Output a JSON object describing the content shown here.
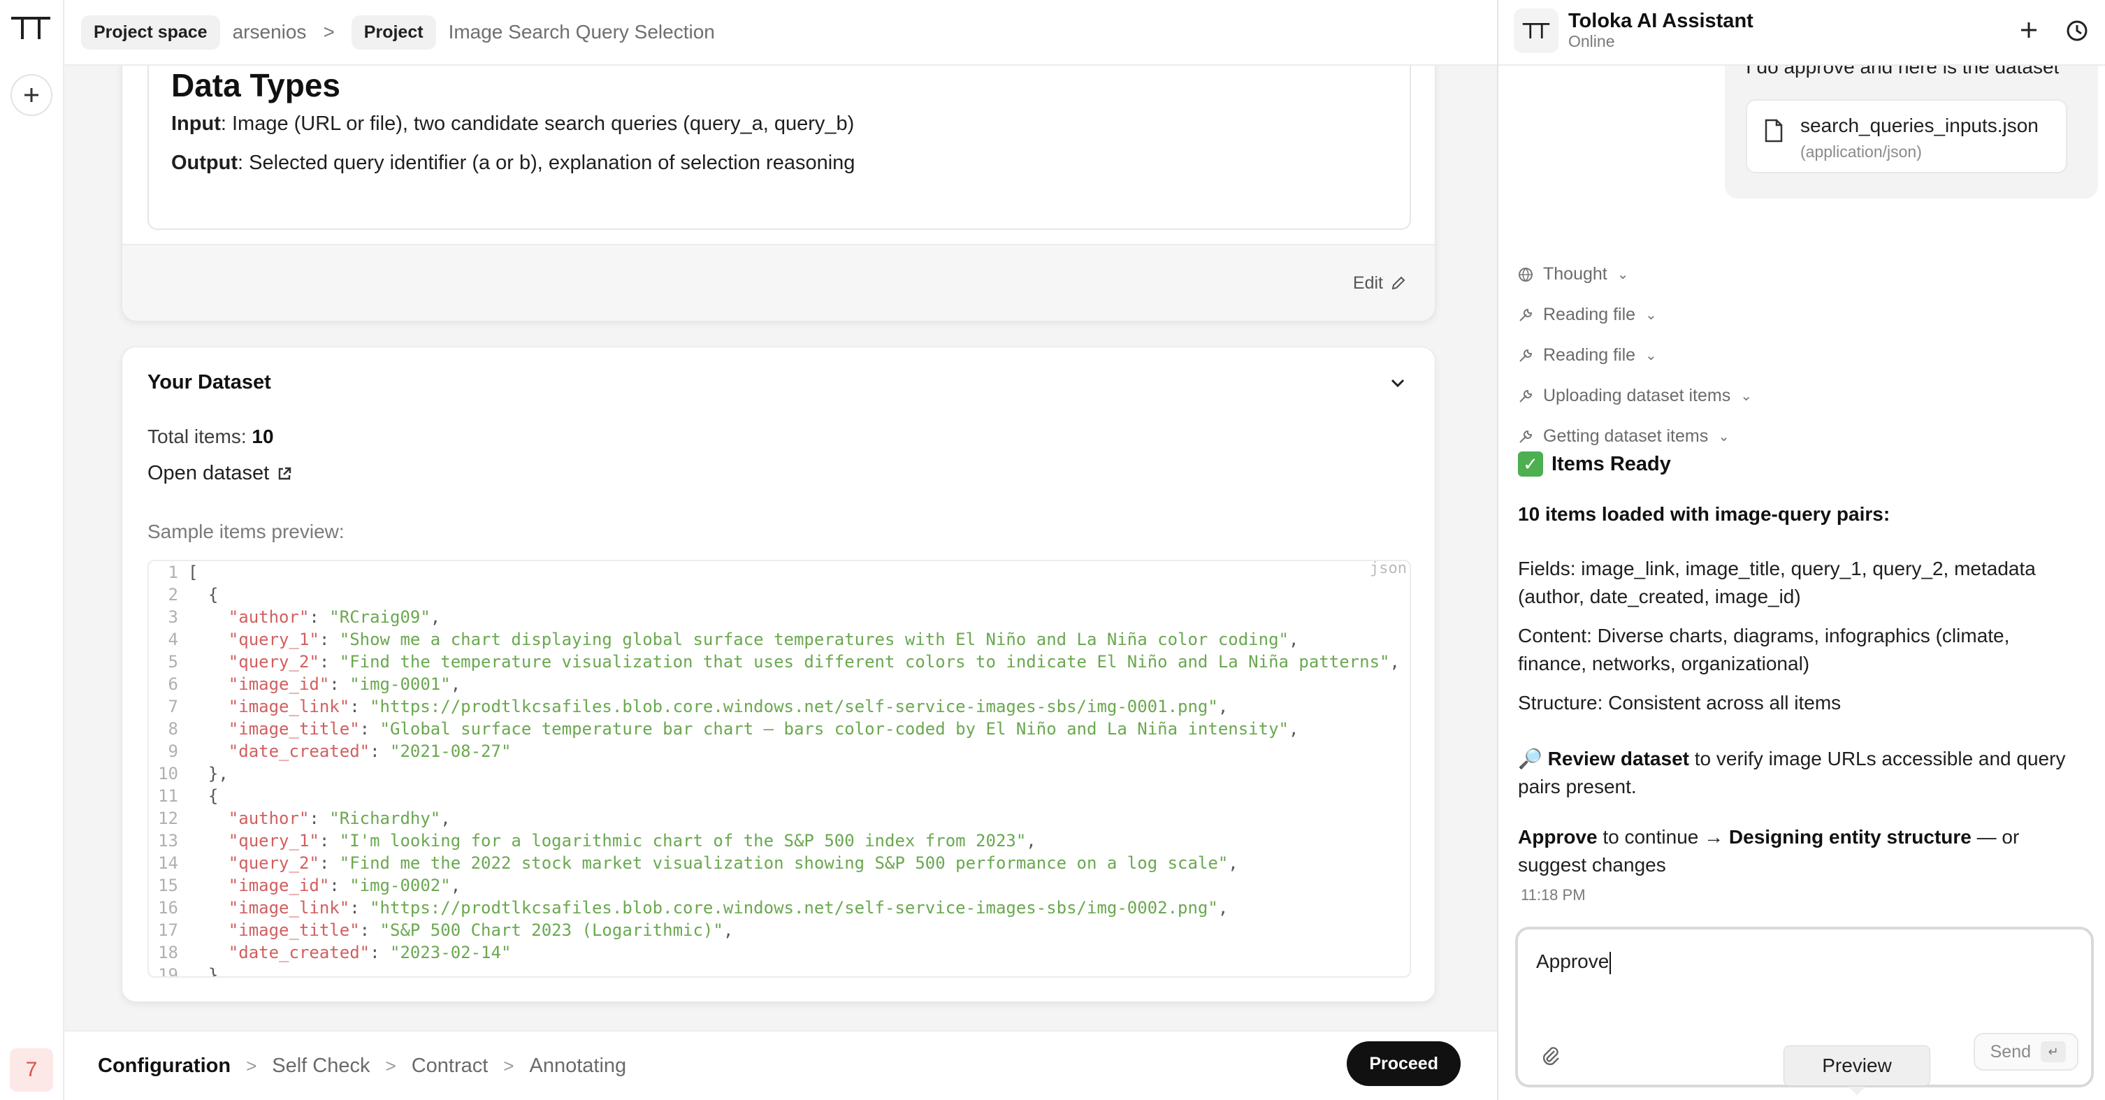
{
  "breadcrumb": {
    "space_chip": "Project space",
    "space_name": "arsenios",
    "sep": ">",
    "project_chip": "Project",
    "project_name": "Image Search Query Selection"
  },
  "rail": {
    "avatar_label": "7"
  },
  "data_types": {
    "title": "Data Types",
    "input_label": "Input",
    "input_text": ": Image (URL or file), two candidate search queries (query_a, query_b)",
    "output_label": "Output",
    "output_text": ": Selected query identifier (a or b), explanation of selection reasoning",
    "edit_label": "Edit"
  },
  "dataset": {
    "title": "Your Dataset",
    "total_label": "Total items:",
    "total_value": "10",
    "open_label": "Open dataset",
    "sample_label": "Sample items preview:",
    "code_lang": "json",
    "code_lines": [
      {
        "n": "1",
        "kind": "punct",
        "indent": "",
        "text": "["
      },
      {
        "n": "2",
        "kind": "punct",
        "indent": "  ",
        "text": "{"
      },
      {
        "n": "3",
        "kind": "kv",
        "indent": "    ",
        "key": "\"author\"",
        "value": "\"RCraig09\"",
        "tail": ","
      },
      {
        "n": "4",
        "kind": "kv",
        "indent": "    ",
        "key": "\"query_1\"",
        "value": "\"Show me a chart displaying global surface temperatures with El Niño and La Niña color coding\"",
        "tail": ","
      },
      {
        "n": "5",
        "kind": "kv",
        "indent": "    ",
        "key": "\"query_2\"",
        "value": "\"Find the temperature visualization that uses different colors to indicate El Niño and La Niña patterns\"",
        "tail": ","
      },
      {
        "n": "6",
        "kind": "kv",
        "indent": "    ",
        "key": "\"image_id\"",
        "value": "\"img-0001\"",
        "tail": ","
      },
      {
        "n": "7",
        "kind": "kv",
        "indent": "    ",
        "key": "\"image_link\"",
        "value": "\"https://prodtlkcsafiles.blob.core.windows.net/self-service-images-sbs/img-0001.png\"",
        "tail": ","
      },
      {
        "n": "8",
        "kind": "kv",
        "indent": "    ",
        "key": "\"image_title\"",
        "value": "\"Global surface temperature bar chart — bars color-coded by El Niño and La Niña intensity\"",
        "tail": ","
      },
      {
        "n": "9",
        "kind": "kv",
        "indent": "    ",
        "key": "\"date_created\"",
        "value": "\"2021-08-27\"",
        "tail": ""
      },
      {
        "n": "10",
        "kind": "punct",
        "indent": "  ",
        "text": "},"
      },
      {
        "n": "11",
        "kind": "punct",
        "indent": "  ",
        "text": "{"
      },
      {
        "n": "12",
        "kind": "kv",
        "indent": "    ",
        "key": "\"author\"",
        "value": "\"Richardhy\"",
        "tail": ","
      },
      {
        "n": "13",
        "kind": "kv",
        "indent": "    ",
        "key": "\"query_1\"",
        "value": "\"I'm looking for a logarithmic chart of the S&P 500 index from 2023\"",
        "tail": ","
      },
      {
        "n": "14",
        "kind": "kv",
        "indent": "    ",
        "key": "\"query_2\"",
        "value": "\"Find me the 2022 stock market visualization showing S&P 500 performance on a log scale\"",
        "tail": ","
      },
      {
        "n": "15",
        "kind": "kv",
        "indent": "    ",
        "key": "\"image_id\"",
        "value": "\"img-0002\"",
        "tail": ","
      },
      {
        "n": "16",
        "kind": "kv",
        "indent": "    ",
        "key": "\"image_link\"",
        "value": "\"https://prodtlkcsafiles.blob.core.windows.net/self-service-images-sbs/img-0002.png\"",
        "tail": ","
      },
      {
        "n": "17",
        "kind": "kv",
        "indent": "    ",
        "key": "\"image_title\"",
        "value": "\"S&P 500 Chart 2023 (Logarithmic)\"",
        "tail": ","
      },
      {
        "n": "18",
        "kind": "kv",
        "indent": "    ",
        "key": "\"date_created\"",
        "value": "\"2023-02-14\"",
        "tail": ""
      },
      {
        "n": "19",
        "kind": "punct",
        "indent": "  ",
        "text": "},"
      }
    ]
  },
  "steps": {
    "items": [
      "Configuration",
      "Self Check",
      "Contract",
      "Annotating"
    ],
    "sep": ">",
    "proceed_label": "Proceed"
  },
  "assistant": {
    "title": "Toloka AI Assistant",
    "status": "Online",
    "user_message": "I do approve and here is the dataset",
    "file_name": "search_queries_inputs.json",
    "file_type": "(application/json)",
    "tool_rows": [
      "Thought",
      "Reading file",
      "Reading file",
      "Uploading dataset items",
      "Getting dataset items"
    ],
    "ready_title": "Items Ready",
    "loaded_heading": "10 items loaded with image-query pairs:",
    "fields_text": "Fields: image_link, image_title, query_1, query_2, metadata (author, date_created, image_id)",
    "content_text": "Content: Diverse charts, diagrams, infographics (climate, finance, networks, organizational)",
    "structure_text": "Structure: Consistent across all items",
    "review_bold": "Review dataset",
    "review_rest": " to verify image URLs accessible and query pairs present.",
    "approve_bold": "Approve",
    "approve_mid": " to continue → ",
    "designing_bold": "Designing entity structure",
    "approve_tail": " — or suggest changes",
    "timestamp": "11:18 PM",
    "input_value": "Approve",
    "send_label": "Send",
    "preview_tooltip": "Preview"
  }
}
